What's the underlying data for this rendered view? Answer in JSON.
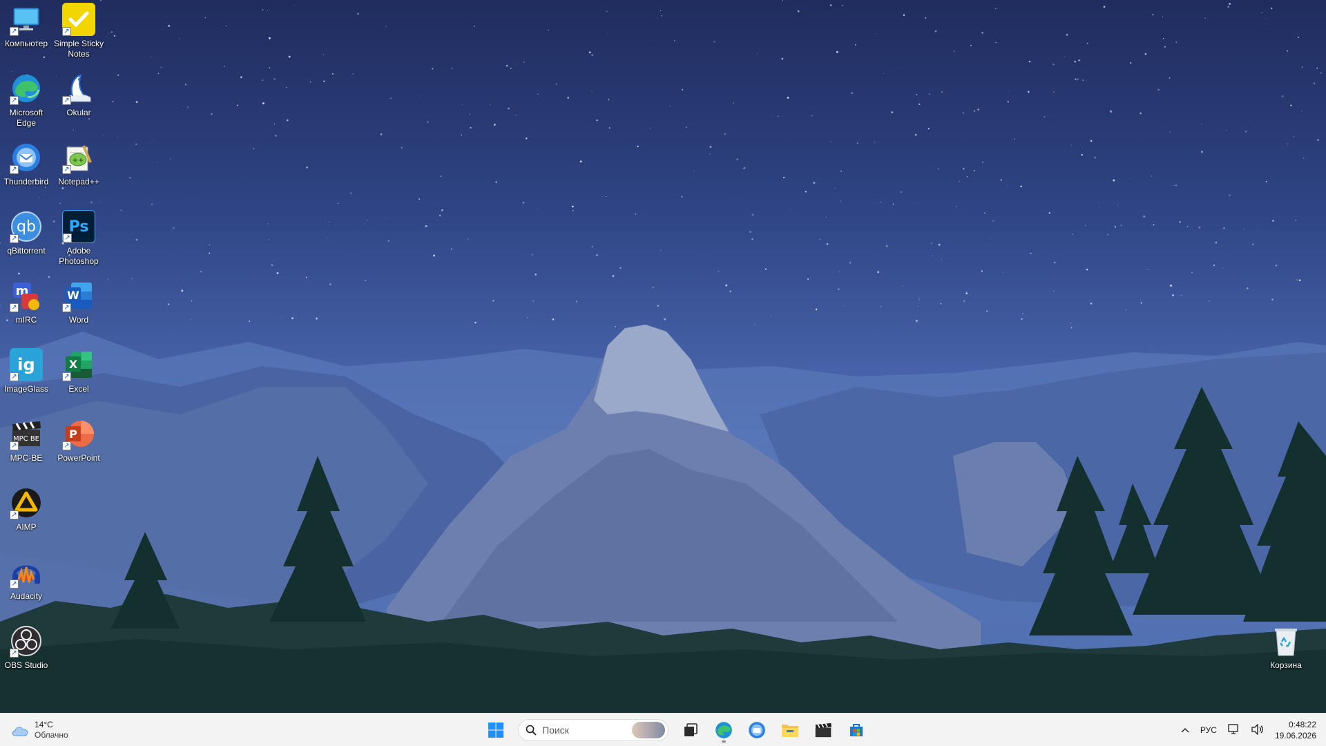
{
  "desktop": {
    "icons_left_col": [
      {
        "id": "computer",
        "label": "Компьютер",
        "icon": "computer-icon",
        "color": "#3aa0e6"
      },
      {
        "id": "edge",
        "label": "Microsoft Edge",
        "icon": "edge-icon",
        "color": "#1f8fd8"
      },
      {
        "id": "thunderbird",
        "label": "Thunderbird",
        "icon": "thunderbird-icon",
        "color": "#2b7fe0"
      },
      {
        "id": "qbittorrent",
        "label": "qBittorrent",
        "icon": "qbittorrent-icon",
        "color": "#3c8fe0"
      },
      {
        "id": "mirc",
        "label": "mIRC",
        "icon": "mirc-icon",
        "color": "#d63a3a"
      },
      {
        "id": "imageglass",
        "label": "ImageGlass",
        "icon": "imageglass-icon",
        "color": "#2aa3d8"
      },
      {
        "id": "mpcbe",
        "label": "MPC-BE",
        "icon": "mpcbe-icon",
        "color": "#333333"
      },
      {
        "id": "aimp",
        "label": "AIMP",
        "icon": "aimp-icon",
        "color": "#f5b800"
      },
      {
        "id": "audacity",
        "label": "Audacity",
        "icon": "audacity-icon",
        "color": "#f08a1c"
      },
      {
        "id": "obs",
        "label": "OBS Studio",
        "icon": "obs-icon",
        "color": "#302e31"
      }
    ],
    "icons_right_col": [
      {
        "id": "stickynotes",
        "label": "Simple Sticky Notes",
        "icon": "sticky-notes-icon",
        "color": "#f2d600"
      },
      {
        "id": "okular",
        "label": "Okular",
        "icon": "okular-icon",
        "color": "#e8eef7"
      },
      {
        "id": "notepadpp",
        "label": "Notepad++",
        "icon": "notepadpp-icon",
        "color": "#7ec850"
      },
      {
        "id": "photoshop",
        "label": "Adobe Photoshop",
        "icon": "photoshop-icon",
        "color": "#001e36"
      },
      {
        "id": "word",
        "label": "Word",
        "icon": "word-icon",
        "color": "#185abd"
      },
      {
        "id": "excel",
        "label": "Excel",
        "icon": "excel-icon",
        "color": "#107c41"
      },
      {
        "id": "powerpoint",
        "label": "PowerPoint",
        "icon": "powerpoint-icon",
        "color": "#c43e1c"
      }
    ],
    "recycle_bin": {
      "label": "Корзина",
      "icon": "recycle-bin-icon"
    }
  },
  "taskbar": {
    "weather": {
      "temp": "14°C",
      "condition": "Облачно"
    },
    "search": {
      "placeholder": "Поиск"
    },
    "pinned": [
      {
        "id": "start",
        "icon": "windows-start-icon"
      },
      {
        "id": "taskview",
        "icon": "task-view-icon"
      },
      {
        "id": "edge",
        "icon": "edge-icon",
        "active": true
      },
      {
        "id": "thunderbird",
        "icon": "thunderbird-icon"
      },
      {
        "id": "explorer",
        "icon": "file-explorer-icon"
      },
      {
        "id": "mpcbe",
        "icon": "mpcbe-icon"
      },
      {
        "id": "store",
        "icon": "microsoft-store-icon"
      }
    ],
    "tray": {
      "language": "РУС",
      "time": "0:48:22",
      "date": "19.06.2026"
    }
  }
}
